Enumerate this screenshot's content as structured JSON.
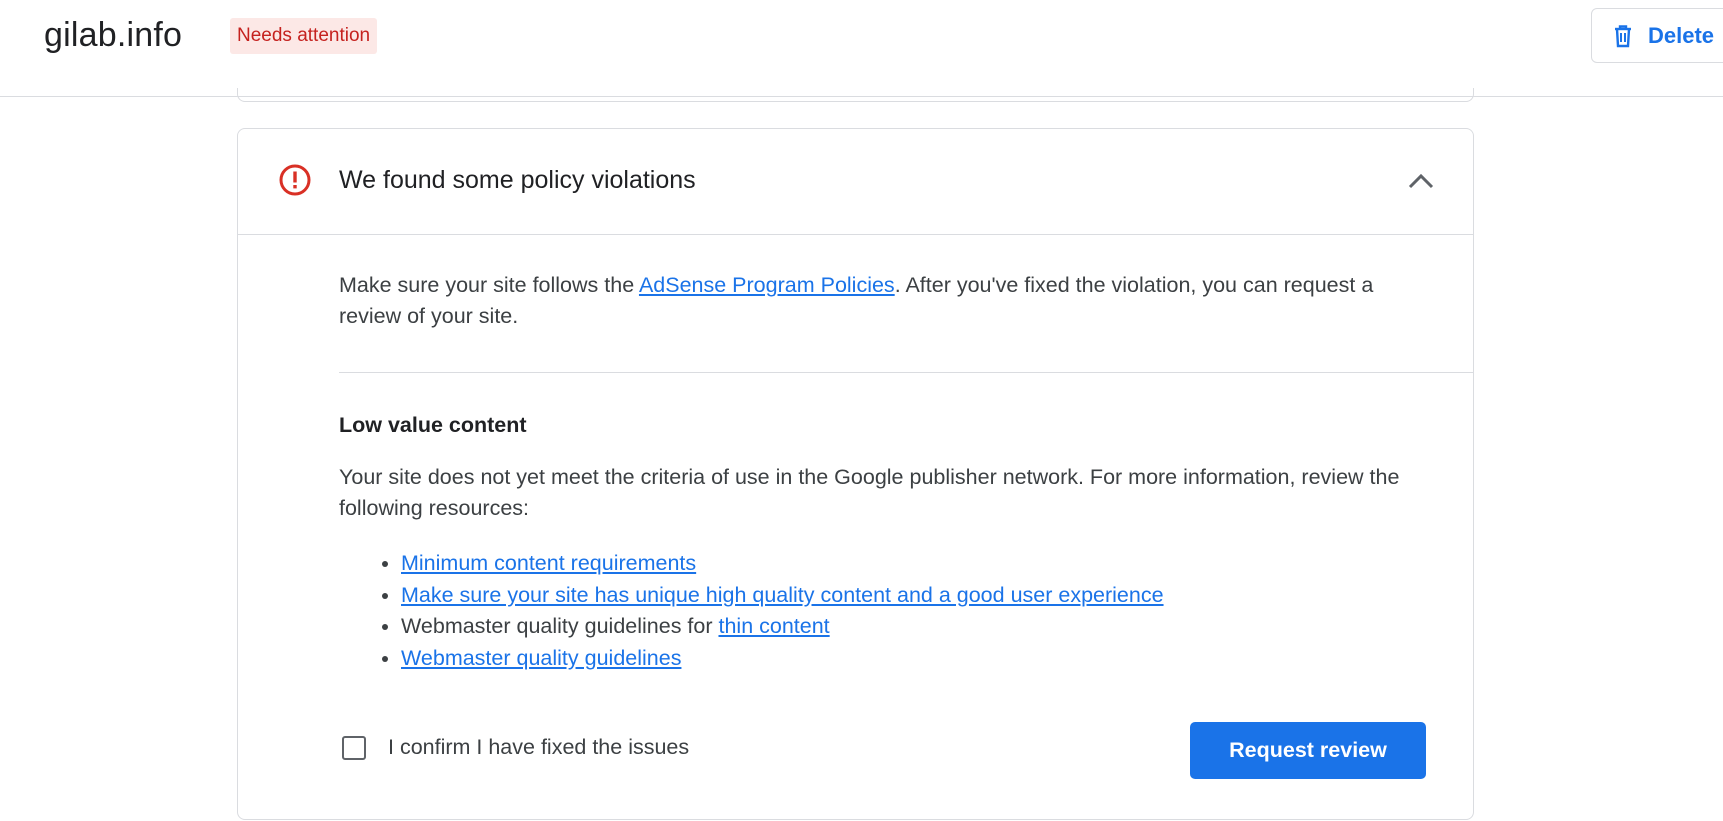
{
  "header": {
    "site_name": "gilab.info",
    "status_badge": "Needs attention",
    "delete_label": "Delete",
    "status_color": "#c5221f",
    "accent_color": "#1a73e8"
  },
  "card": {
    "title": "We found some policy violations",
    "intro": {
      "before": "Make sure your site follows the ",
      "link": "AdSense Program Policies",
      "after": ". After you've fixed the violation, you can request a review of your site."
    },
    "issue": {
      "title": "Low value content",
      "text": "Your site does not yet meet the criteria of use in the Google publisher network. For more information, review the following resources:",
      "resources": [
        {
          "prefix": "",
          "link": "Minimum content requirements"
        },
        {
          "prefix": "",
          "link": "Make sure your site has unique high quality content and a good user experience"
        },
        {
          "prefix": "Webmaster quality guidelines for ",
          "link": "thin content"
        },
        {
          "prefix": "",
          "link": "Webmaster quality guidelines"
        }
      ]
    },
    "confirm_label": "I confirm I have fixed the issues",
    "confirm_checked": false,
    "request_review_label": "Request review"
  },
  "icons": {
    "alert": "error-circle-icon",
    "collapse": "chevron-up-icon",
    "delete": "trash-icon"
  }
}
